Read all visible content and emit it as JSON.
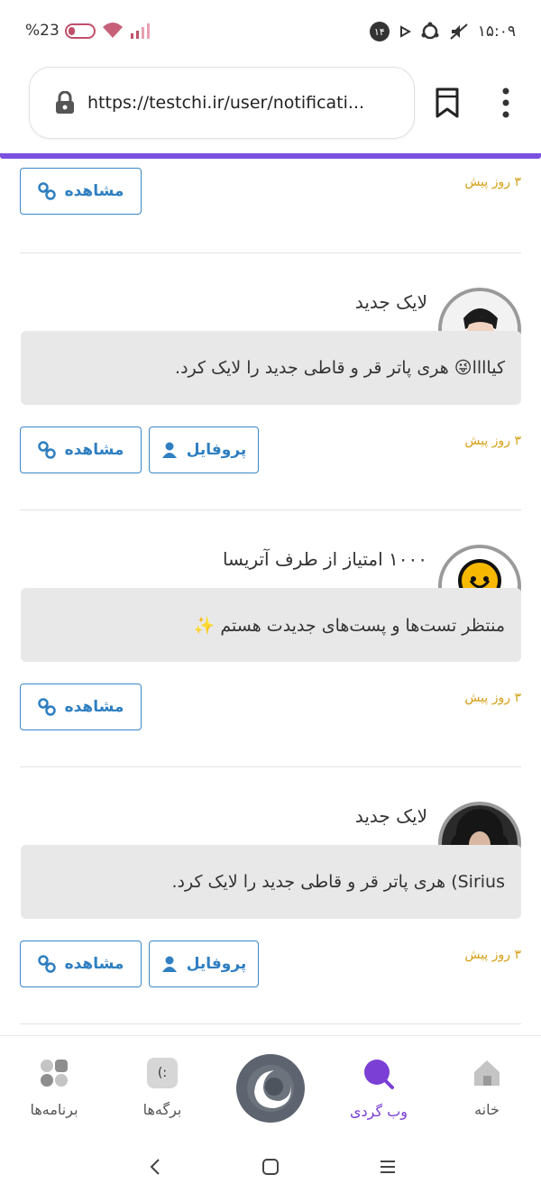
{
  "status_bar": {
    "battery": "%23",
    "time": "۱۵:۰۹",
    "notif_count": "۱۴"
  },
  "browser": {
    "url": "https://testchi.ir/user/notificati..."
  },
  "notifications": [
    {
      "time": "۳ روز پیش",
      "view_label": "مشاهده"
    },
    {
      "title": "لایک جدید",
      "message": "کیاااا😜 هری پاتر قر و قاطی جدید را لایک کرد.",
      "time": "۳ روز پیش",
      "view_label": "مشاهده",
      "profile_label": "پروفایل"
    },
    {
      "title": "۱۰۰۰ امتیاز از طرف آتریسا",
      "message": "منتظر تست‌ها و پست‌های جدیدت هستم ✨",
      "time": "۳ روز پیش",
      "view_label": "مشاهده"
    },
    {
      "title": "لایک جدید",
      "message": "Sirius) هری پاتر قر و قاطی جدید را لایک کرد.",
      "time": "۳ روز پیش",
      "view_label": "مشاهده",
      "profile_label": "پروفایل"
    }
  ],
  "bottom_nav": {
    "home": "خانه",
    "browse": "وب گردی",
    "pages": "برگه‌ها",
    "apps": "برنامه‌ها",
    "pages_icon_text": "(:"
  },
  "colors": {
    "accent": "#7b4fe0",
    "button": "#2f7fc1",
    "time": "#d4a017"
  }
}
